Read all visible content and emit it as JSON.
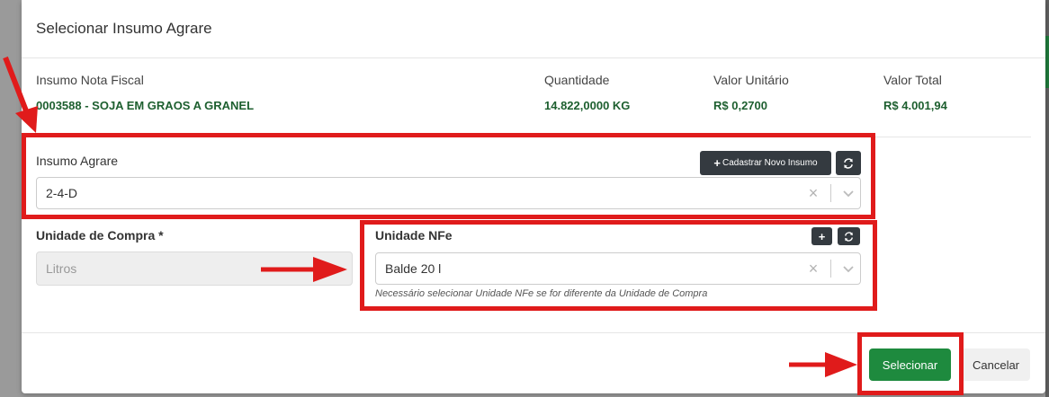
{
  "modal": {
    "title": "Selecionar Insumo Agrare"
  },
  "summary": {
    "insumo_label": "Insumo Nota Fiscal",
    "insumo_value": "0003588 - SOJA EM GRAOS A GRANEL",
    "quantidade_label": "Quantidade",
    "quantidade_value": "14.822,0000 KG",
    "valor_unitario_label": "Valor Unitário",
    "valor_unitario_value": "R$ 0,2700",
    "valor_total_label": "Valor Total",
    "valor_total_value": "R$ 4.001,94"
  },
  "insumo_agrare": {
    "label": "Insumo Agrare",
    "new_button_label": "Cadastrar Novo Insumo",
    "value": "2-4-D"
  },
  "unidade_compra": {
    "label": "Unidade de Compra *",
    "value": "Litros"
  },
  "unidade_nfe": {
    "label": "Unidade NFe",
    "value": "Balde 20 l",
    "help": "Necessário selecionar Unidade NFe se for diferente da Unidade de Compra"
  },
  "footer": {
    "select_label": "Selecionar",
    "cancel_label": "Cancelar"
  },
  "icons": {
    "plus": "+",
    "refresh": "refresh-icon",
    "clear": "×",
    "chevron": "chevron-down-icon"
  },
  "colors": {
    "accent_green": "#1e8a3e",
    "value_green": "#1d5f2f",
    "dark_button": "#343a40",
    "annotation_red": "#e01b1b"
  }
}
